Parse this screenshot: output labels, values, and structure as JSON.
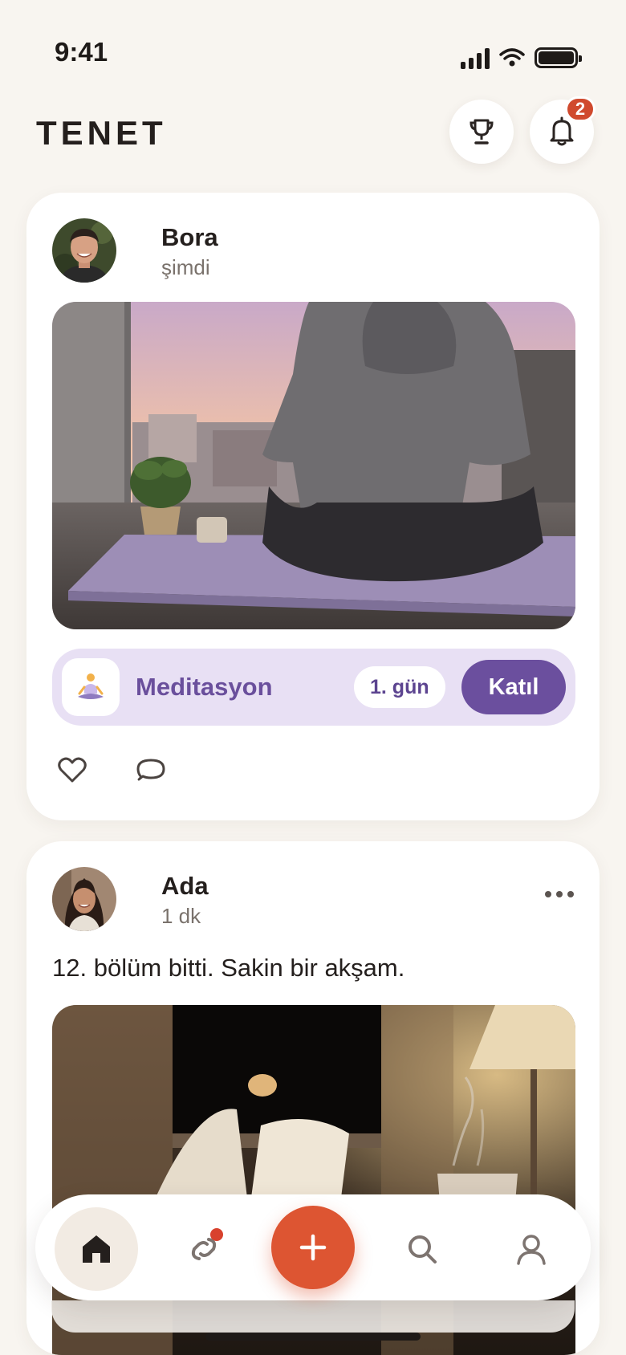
{
  "status_bar": {
    "time": "9:41"
  },
  "header": {
    "logo": "TENET",
    "trophy_icon": "trophy-icon",
    "bell_icon": "bell-icon",
    "notification_count": "2"
  },
  "posts": [
    {
      "author": "Bora",
      "time": "şimdi",
      "photo_icon": "meditation-photo",
      "habit": {
        "emoji": "🧘",
        "name": "Meditasyon",
        "day": "1. gün",
        "join_label": "Katıl"
      },
      "actions": [
        "heart-icon",
        "comment-icon"
      ]
    },
    {
      "author": "Ada",
      "time": "1 dk",
      "text": "12. bölüm bitti. Sakin bir akşam.",
      "photo_icon": "reading-photo"
    }
  ],
  "bottom_nav": {
    "items": [
      "home-icon",
      "streak-icon",
      "plus-icon",
      "search-icon",
      "profile-icon"
    ]
  },
  "colors": {
    "background": "#f8f5f0",
    "accent": "#dd5532",
    "habit_purple": "#6b4f9e",
    "habit_bg": "#e8e0f4",
    "badge_red": "#d04a2e"
  }
}
